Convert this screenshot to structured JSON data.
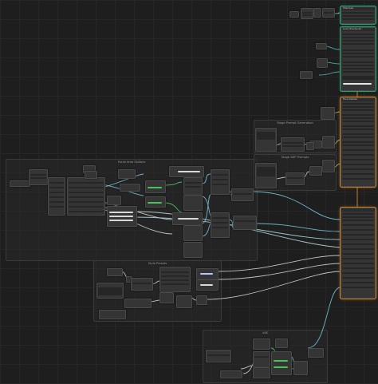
{
  "groups": {
    "facial": "Facial Area Options",
    "stage_prompt": "Stage Prompt Generation",
    "stage_sdp": "Stage SDP Prompts",
    "style": "Style Presets",
    "vae": "VAE"
  },
  "nodes": {
    "title_sampler": "KSampler",
    "title_loader": "Load Checkpoint",
    "title_main": "Face Detailer"
  }
}
